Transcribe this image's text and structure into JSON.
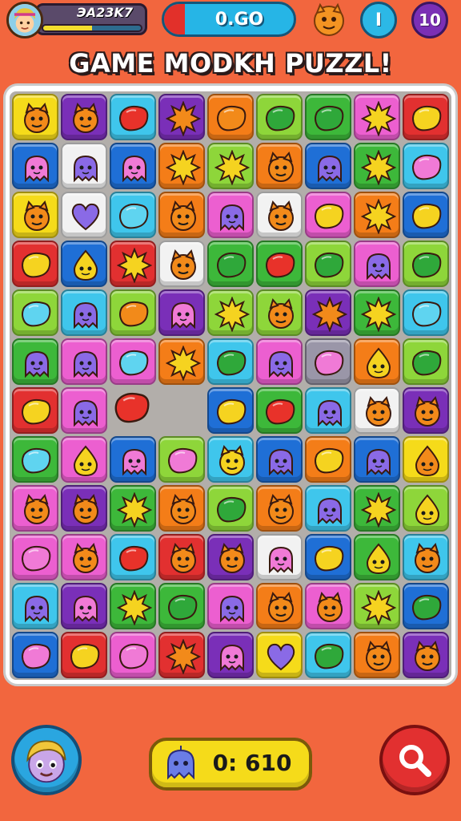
{
  "hud": {
    "player_name": "ЭA23K7",
    "xp_progress": 0.5,
    "power_value": "0.GO",
    "moves": "I",
    "level": "10"
  },
  "title": "GAME MODKH PUZZL!",
  "score": {
    "value": "0: 610"
  },
  "colors": {
    "background": "#f2663e",
    "board": "#b2aeaa",
    "yellow": "#f5db1a",
    "green": "#3db83a",
    "lime": "#8ed63a",
    "blue": "#1f6fd6",
    "cyan": "#3fc6ec",
    "purple": "#7a2fb8",
    "pink": "#ec5fd0",
    "orange": "#f47d18",
    "red": "#e23030",
    "white": "#f2f2f2"
  },
  "board": {
    "cols": 9,
    "rows": 12,
    "cells": [
      [
        "yellow:monster-orange",
        "purple:monster-orange",
        "cyan:candy-red",
        "purple:burst-orange",
        "orange:candy-orange",
        "lime:candy-green",
        "green:candy-green",
        "pink:burst-yellow",
        "red:candy-yellow"
      ],
      [
        "blue:ghost-pink",
        "white:ghost-purple",
        "blue:ghost-pink",
        "orange:burst-yellow",
        "lime:burst-yellow",
        "orange:monster-orange",
        "blue:ghost-purple",
        "green:burst-yellow",
        "cyan:candy-pink"
      ],
      [
        "yellow:monster-orange",
        "white:heart-purple",
        "cyan:candy-cyan",
        "orange:monster-orange",
        "pink:ghost-purple",
        "white:monster-orange",
        "pink:candy-yellow",
        "orange:burst-yellow",
        "blue:candy-yellow"
      ],
      [
        "red:candy-yellow",
        "blue:drop-yellow",
        "red:burst-yellow",
        "white:monster-orange",
        "green:candy-green",
        "green:candy-red",
        "lime:candy-green",
        "pink:ghost-purple",
        "lime:candy-green"
      ],
      [
        "lime:candy-cyan",
        "cyan:ghost-purple",
        "lime:candy-orange",
        "purple:ghost-pink",
        "lime:burst-yellow",
        "lime:monster-orange",
        "purple:burst-orange",
        "green:burst-yellow",
        "cyan:candy-cyan"
      ],
      [
        "green:ghost-purple",
        "pink:ghost-purple",
        "pink:candy-cyan",
        "orange:burst-yellow",
        "cyan:candy-green",
        "pink:ghost-purple",
        "gray:candy-pink",
        "orange:drop-yellow",
        "lime:candy-green"
      ],
      [
        "red:candy-yellow",
        "pink:ghost-purple",
        "empty:none",
        "empty:none",
        "blue:candy-yellow",
        "green:candy-red",
        "cyan:ghost-purple",
        "white:monster-orange",
        "purple:monster-orange"
      ],
      [
        "green:candy-cyan",
        "pink:drop-yellow",
        "blue:ghost-pink",
        "lime:candy-pink",
        "cyan:monster-yellow",
        "blue:ghost-purple",
        "orange:candy-yellow",
        "blue:ghost-purple",
        "yellow:drop-orange"
      ],
      [
        "pink:monster-orange",
        "purple:monster-orange",
        "green:burst-yellow",
        "orange:monster-orange",
        "lime:candy-green",
        "orange:monster-orange",
        "cyan:ghost-purple",
        "green:burst-yellow",
        "lime:drop-yellow"
      ],
      [
        "pink:candy-pink",
        "pink:monster-orange",
        "cyan:candy-red",
        "red:monster-orange",
        "purple:monster-orange",
        "white:ghost-pink",
        "blue:candy-yellow",
        "green:drop-yellow",
        "cyan:monster-orange"
      ],
      [
        "cyan:ghost-purple",
        "purple:ghost-pink",
        "green:burst-yellow",
        "green:candy-green",
        "pink:ghost-purple",
        "orange:monster-orange",
        "pink:monster-orange",
        "lime:burst-yellow",
        "blue:candy-green"
      ],
      [
        "blue:candy-pink",
        "red:candy-yellow",
        "pink:candy-pink",
        "red:burst-orange",
        "purple:ghost-pink",
        "yellow:heart-purple",
        "cyan:candy-green",
        "orange:monster-orange",
        "purple:monster-orange"
      ]
    ],
    "floating": [
      {
        "shape": "candy",
        "color": "red"
      },
      {
        "shape": "candy",
        "color": "pink"
      }
    ]
  },
  "icons": {
    "avatar": "hero-avatar-icon",
    "pet": "orange-monster-icon",
    "score": "blue-ghost-icon",
    "search": "magnifier-icon"
  }
}
